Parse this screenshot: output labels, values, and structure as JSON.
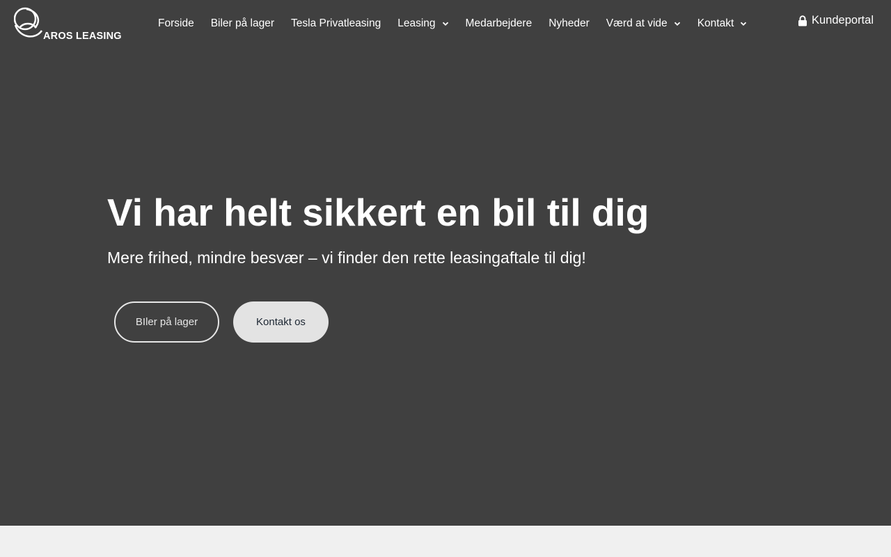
{
  "brand": {
    "name": "AROS LEASING"
  },
  "nav": {
    "items": [
      {
        "label": "Forside",
        "dropdown": false
      },
      {
        "label": "Biler på lager",
        "dropdown": false
      },
      {
        "label": "Tesla Privatleasing",
        "dropdown": false
      },
      {
        "label": "Leasing",
        "dropdown": true
      },
      {
        "label": "Medarbejdere",
        "dropdown": false
      },
      {
        "label": "Nyheder",
        "dropdown": false
      },
      {
        "label": "Værd at vide",
        "dropdown": true
      },
      {
        "label": "Kontakt",
        "dropdown": true
      }
    ],
    "portal": {
      "label": "Kundeportal",
      "icon": "lock-icon"
    }
  },
  "hero": {
    "title": "Vi har helt sikkert en bil til dig",
    "subtitle": "Mere frihed, mindre besvær – vi finder den rette leasingaftale til dig!",
    "buttons": {
      "primary": "BIler på lager",
      "secondary": "Kontakt os"
    }
  },
  "colors": {
    "hero_background": "#404040",
    "page_background": "#f0f0f0",
    "text": "#ffffff",
    "button_fill": "#e3e3e3",
    "button_text_dark": "#1d2733"
  }
}
